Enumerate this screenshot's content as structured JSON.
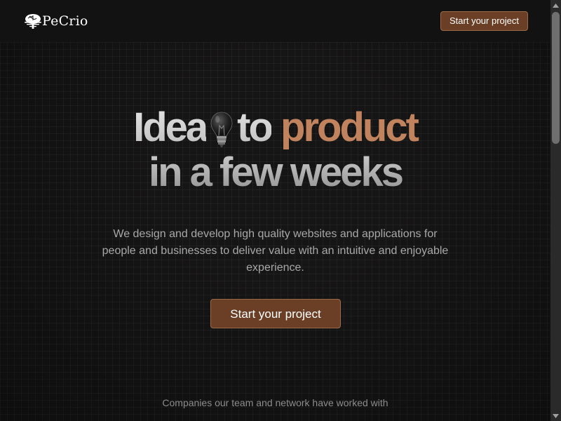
{
  "header": {
    "brand": "PeCrio",
    "cta_label": "Start your project"
  },
  "hero": {
    "title_word1": "Idea",
    "title_word2": "to",
    "title_accent": "product",
    "title_line2": "in a few weeks",
    "subtitle": "We design and develop high quality websites and applications for people and businesses to deliver value with an intuitive and enjoyable experience.",
    "cta_label": "Start your project"
  },
  "companies": {
    "heading": "Companies our team and network have worked with"
  },
  "colors": {
    "accent": "#c1835d",
    "button_bg": "#6b3f25",
    "background": "#161515"
  },
  "icons": {
    "logo": "brain-tree-icon",
    "title_icon": "lightbulb-icon"
  }
}
